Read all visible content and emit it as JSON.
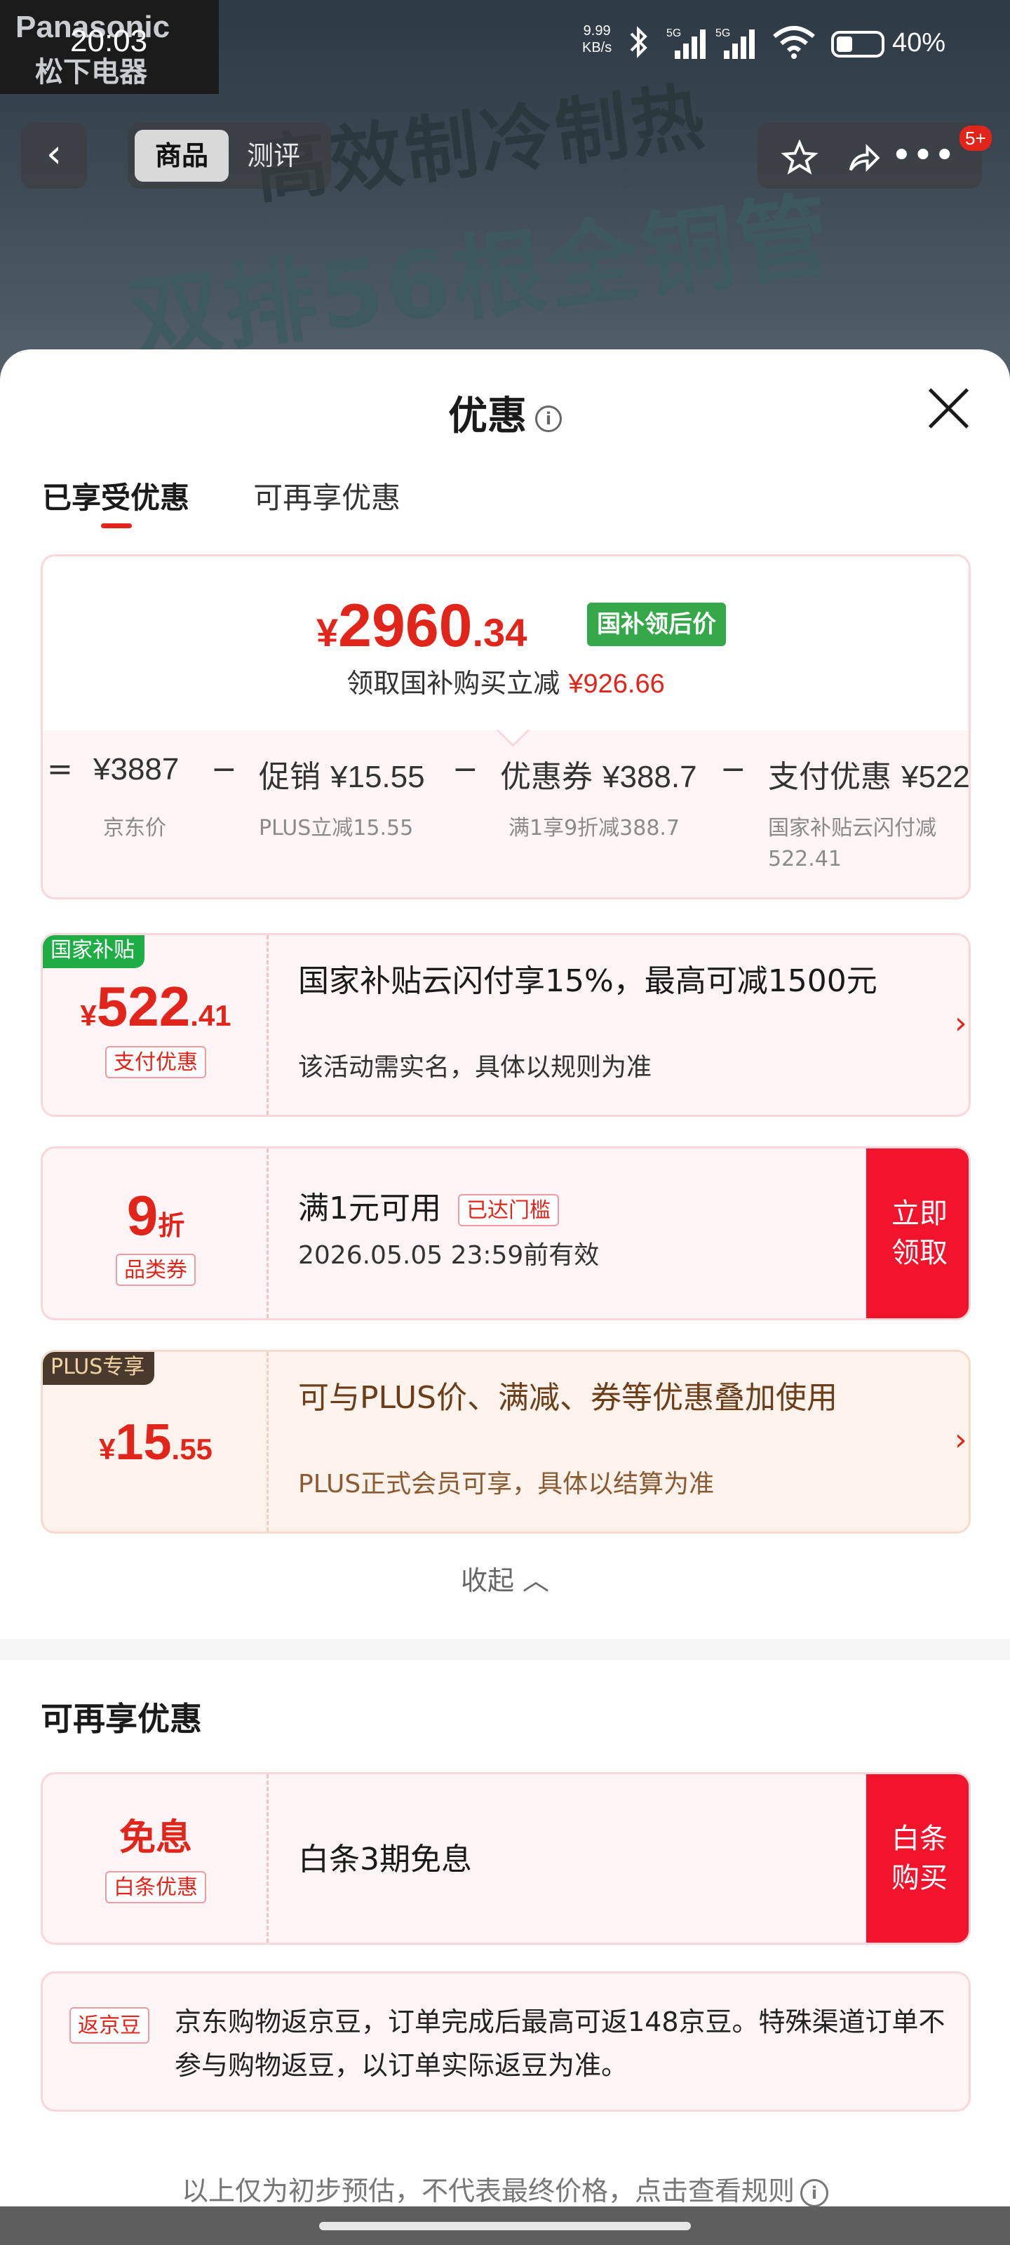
{
  "status": {
    "time": "20:03",
    "speed_value": "9.99",
    "speed_unit": "KB/s",
    "battery": "40%"
  },
  "hero": {
    "brand_name": "Panasonic",
    "brand_cn": "松下电器",
    "slogan1": "高效制冷制热",
    "slogan2": "双排56根全铜管"
  },
  "nav": {
    "tab_product": "商品",
    "tab_review": "测评",
    "badge": "5+"
  },
  "sheet": {
    "title": "优惠",
    "tabs": [
      "已享受优惠",
      "可再享优惠"
    ]
  },
  "price": {
    "currency": "¥",
    "int": "2960",
    "dec": ".34",
    "tag": "国补领后价",
    "save_text": "领取国补购买立减",
    "save_amount": "¥926.66",
    "calc": {
      "eq": "=",
      "jd_price": "¥3887",
      "jd_label": "京东价",
      "promo_label": "促销",
      "promo_val": "¥15.55",
      "promo_sub": "PLUS立减15.55",
      "coupon_label": "优惠券",
      "coupon_val": "¥388.7",
      "coupon_sub": "满1享9折减388.7",
      "pay_label": "支付优惠",
      "pay_val": "¥522",
      "pay_sub": "国家补贴云闪付减522.41",
      "minus": "−"
    }
  },
  "coupons": [
    {
      "corner": "国家补贴",
      "corner_color": "#1fae45",
      "cur": "¥",
      "int": "522",
      "dec": ".41",
      "kind": "支付优惠",
      "title": "国家补贴云闪付享15%，最高可减1500元",
      "desc": "该活动需实名，具体以规则为准"
    },
    {
      "int": "9",
      "unit": "折",
      "kind": "品类券",
      "title": "满1元可用",
      "status_tag": "已达门槛",
      "desc": "2026.05.05 23:59前有效",
      "action": "立即领取"
    },
    {
      "corner": "PLUS专享",
      "corner_color": "#4a3a2e",
      "cur": "¥",
      "int": "15",
      "dec": ".55",
      "title": "可与PLUS价、满减、券等优惠叠加使用",
      "desc": "PLUS正式会员可享，具体以结算为准"
    }
  ],
  "collapse": "收起",
  "more_section": {
    "title": "可再享优惠",
    "card": {
      "amount": "免息",
      "kind": "白条优惠",
      "title": "白条3期免息",
      "action": "白条购买"
    }
  },
  "bean": {
    "tag": "返京豆",
    "text": "京东购物返京豆，订单完成后最高可返148京豆。特殊渠道订单不参与购物返豆，以订单实际返豆为准。"
  },
  "footer": "以上仅为初步预估，不代表最终价格，点击查看规则",
  "colors": {
    "accent": "#e1251b",
    "green": "#35a94a",
    "action_red": "#f2142c"
  }
}
